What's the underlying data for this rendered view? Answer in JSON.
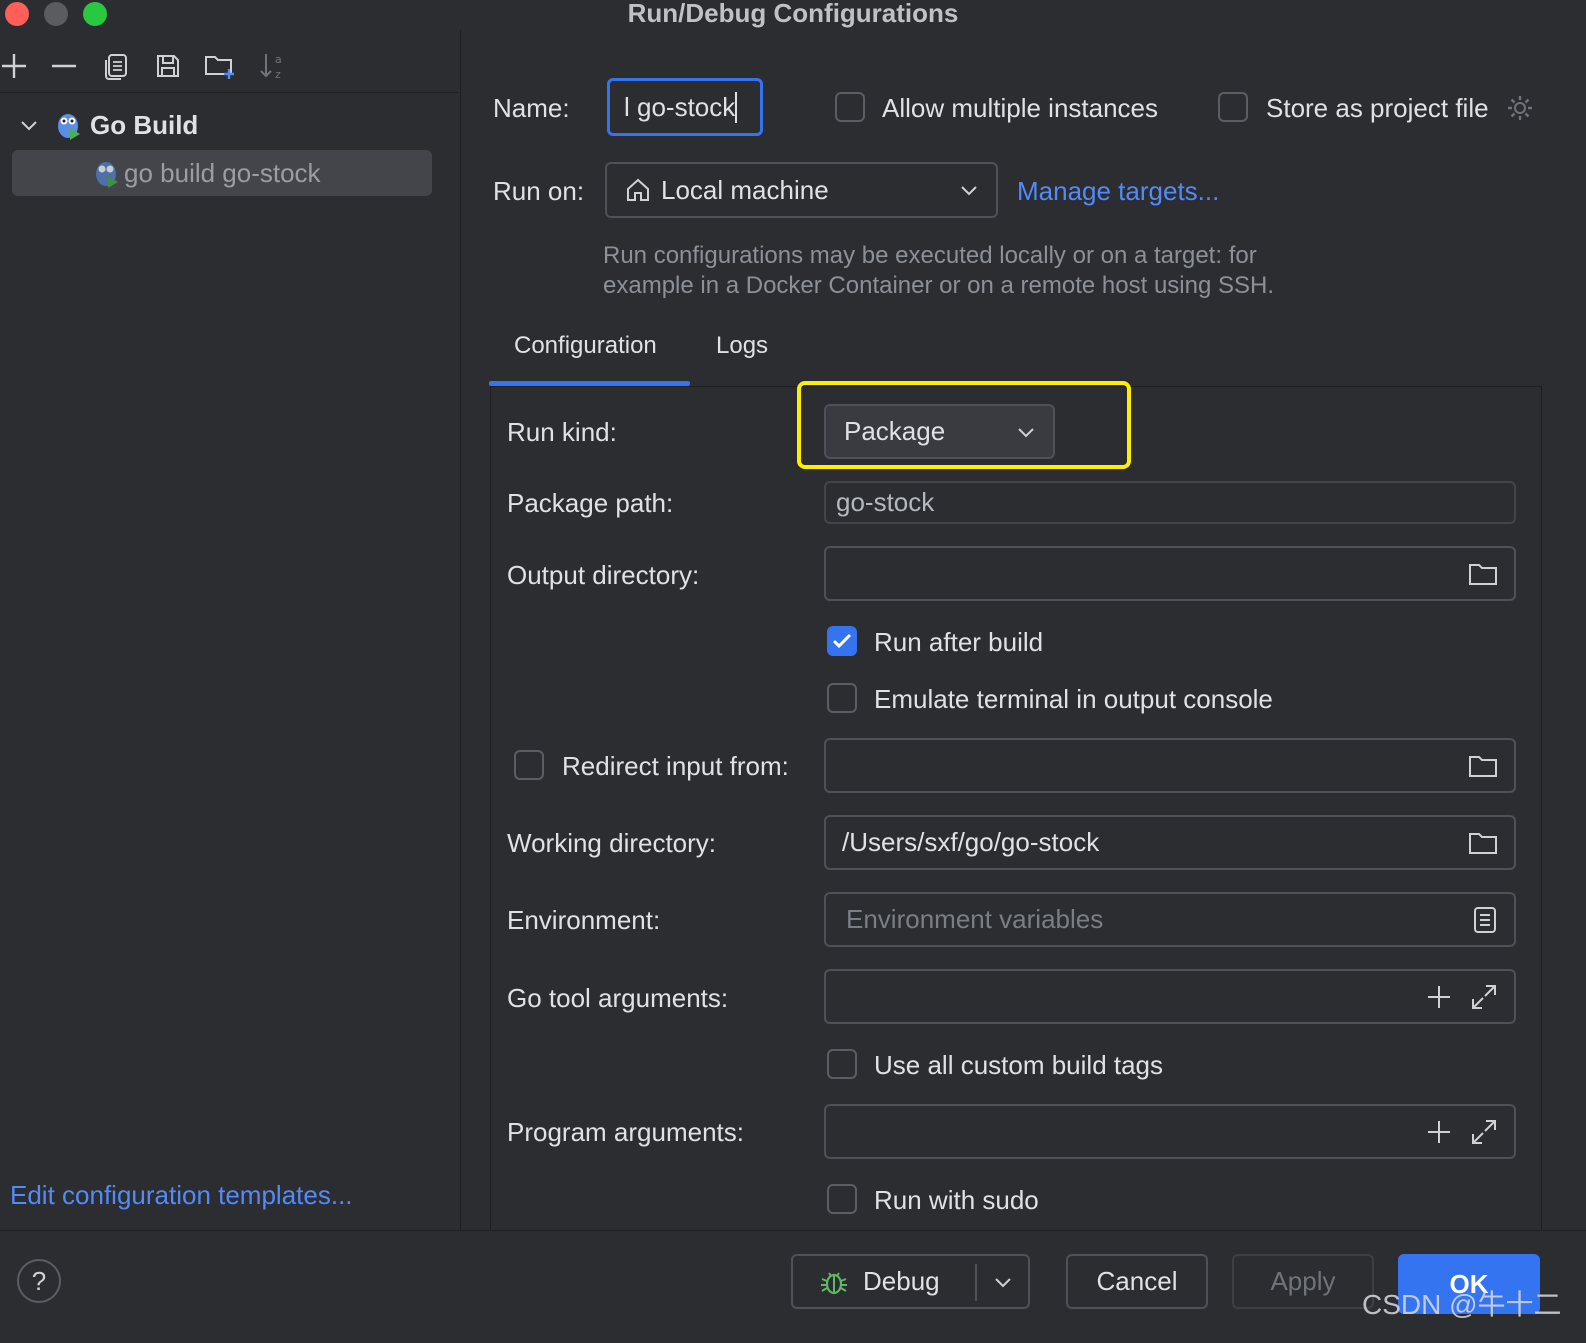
{
  "window": {
    "title": "Run/Debug Configurations"
  },
  "sidebar": {
    "group_label": "Go Build",
    "item_label": "go build go-stock",
    "templates_link": "Edit configuration templates..."
  },
  "header": {
    "name_label": "Name:",
    "name_value": "l go-stock",
    "allow_multiple": "Allow multiple instances",
    "store_project": "Store as project file",
    "run_on_label": "Run on:",
    "run_on_value": "Local machine",
    "manage_targets": "Manage targets...",
    "hint_line1": "Run configurations may be executed locally or on a target: for",
    "hint_line2": "example in a Docker Container or on a remote host using SSH."
  },
  "tabs": [
    {
      "label": "Configuration",
      "active": true
    },
    {
      "label": "Logs",
      "active": false
    }
  ],
  "form": {
    "run_kind_label": "Run kind:",
    "run_kind_value": "Package",
    "package_path_label": "Package path:",
    "package_path_value": "go-stock",
    "output_dir_label": "Output directory:",
    "output_dir_value": "",
    "run_after_build": {
      "label": "Run after build",
      "checked": true
    },
    "emulate_terminal": {
      "label": "Emulate terminal in output console",
      "checked": false
    },
    "redirect_input": {
      "label": "Redirect input from:",
      "checked": false
    },
    "working_dir_label": "Working directory:",
    "working_dir_value": "/Users/sxf/go/go-stock",
    "environment_label": "Environment:",
    "environment_placeholder": "Environment variables",
    "go_tool_args_label": "Go tool arguments:",
    "custom_build_tags": {
      "label": "Use all custom build tags",
      "checked": false
    },
    "program_args_label": "Program arguments:",
    "run_with_sudo": {
      "label": "Run with sudo",
      "checked": false
    }
  },
  "footer": {
    "help": "?",
    "debug": "Debug",
    "cancel": "Cancel",
    "apply": "Apply",
    "ok": "OK",
    "watermark": "CSDN @牛十二"
  },
  "colors": {
    "accent": "#3574f0",
    "link": "#548af7",
    "highlight": "#ffee00",
    "background": "#2b2d30"
  }
}
